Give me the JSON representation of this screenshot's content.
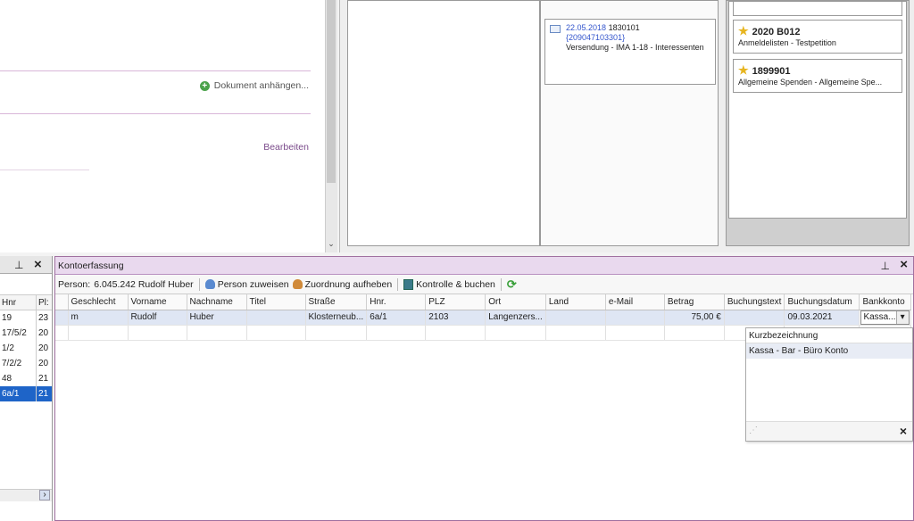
{
  "doc_panel": {
    "attach_label": "Dokument anhängen...",
    "edit_label": "Bearbeiten"
  },
  "right_panel": {
    "mail_card": {
      "date": "22.05.2018",
      "number": "1830101",
      "ref": "{209047103301}",
      "desc": "Versendung - IMA 1-18 - Interessenten"
    },
    "star_cards": [
      {
        "code": "2020 B012",
        "desc": "Anmeldelisten - Testpetition"
      },
      {
        "code": "1899901",
        "desc": "Allgemeine Spenden - Allgemeine Spe..."
      }
    ]
  },
  "left_list": {
    "headers": [
      "Hnr",
      "Pl:"
    ],
    "rows": [
      [
        "19",
        "23"
      ],
      [
        "17/5/2",
        "20"
      ],
      [
        "1/2",
        "20"
      ],
      [
        "7/2/2",
        "20"
      ],
      [
        "48",
        "21"
      ],
      [
        "6a/1",
        "21"
      ]
    ]
  },
  "konto": {
    "title": "Kontoerfassung",
    "person_label": "Person:",
    "person_value": "6.045.242 Rudolf Huber",
    "btn_assign": "Person zuweisen",
    "btn_unassign": "Zuordnung aufheben",
    "btn_check": "Kontrolle & buchen",
    "columns": [
      "Geschlecht",
      "Vorname",
      "Nachname",
      "Titel",
      "Straße",
      "Hnr.",
      "PLZ",
      "Ort",
      "Land",
      "e-Mail",
      "Betrag",
      "Buchungstext",
      "Buchungsdatum",
      "Bankkonto"
    ],
    "row": {
      "geschlecht": "m",
      "vorname": "Rudolf",
      "nachname": "Huber",
      "titel": "",
      "strasse": "Klosterneub...",
      "hnr": "6a/1",
      "plz": "2103",
      "ort": "Langenzers...",
      "land": "",
      "email": "",
      "betrag": "75,00 €",
      "buchungstext": "",
      "buchungsdatum": "09.03.2021",
      "bankkonto": "Kassa..."
    },
    "dropdown": {
      "header": "Kurzbezeichnung",
      "item": "Kassa - Bar - Büro Konto"
    }
  },
  "icons": {
    "close": "×",
    "pin": "⊥",
    "chevron_down": "⌄",
    "dropdown_arrow": "▾",
    "scroll_right": "›",
    "resize": "⋰",
    "plus": "+",
    "star": "★",
    "refresh": "⟳"
  }
}
